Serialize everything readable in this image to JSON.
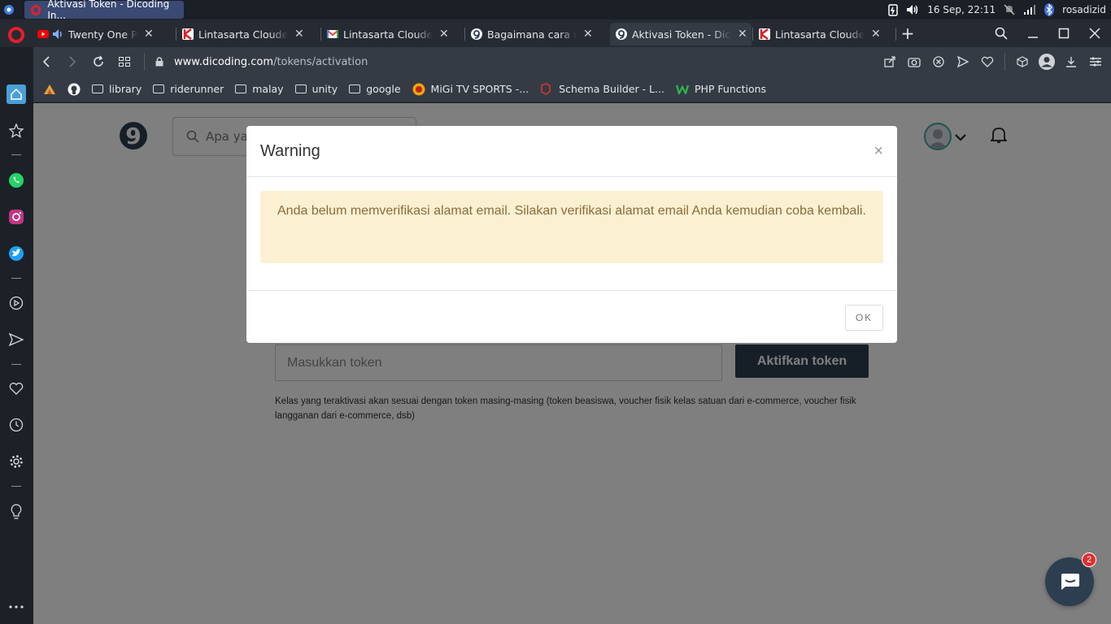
{
  "os": {
    "active_window_title": "Aktivasi Token - Dicoding In...",
    "datetime": "16 Sep, 22:11",
    "user": "rosadizid"
  },
  "tabs": [
    {
      "title": "Twenty One Pilots",
      "favicon": "youtube-icon",
      "active": false
    },
    {
      "title": "Lintasarta Cloudeka D",
      "favicon": "cloudeka-icon",
      "active": false
    },
    {
      "title": "Lintasarta Cloudeka D",
      "favicon": "gmail-icon",
      "active": false
    },
    {
      "title": "Bagaimana cara mem",
      "favicon": "dicoding-icon",
      "active": false
    },
    {
      "title": "Aktivasi Token - Dicod",
      "favicon": "dicoding-icon",
      "active": true
    },
    {
      "title": "Lintasarta Cloudeka D",
      "favicon": "cloudeka-icon",
      "active": false
    }
  ],
  "address": {
    "host": "www.dicoding.com",
    "path": "/tokens/activation"
  },
  "bookmarks": [
    {
      "label": "",
      "icon": "bookmark-app-icon"
    },
    {
      "label": "",
      "icon": "github-icon"
    },
    {
      "label": "library",
      "icon": "folder-icon"
    },
    {
      "label": "riderunner",
      "icon": "folder-icon"
    },
    {
      "label": "malay",
      "icon": "folder-icon"
    },
    {
      "label": "unity",
      "icon": "folder-icon"
    },
    {
      "label": "google",
      "icon": "folder-icon"
    },
    {
      "label": "MiGi TV SPORTS -...",
      "icon": "migi-icon"
    },
    {
      "label": "Schema Builder - L...",
      "icon": "laravel-icon"
    },
    {
      "label": "PHP Functions",
      "icon": "w-icon"
    }
  ],
  "page": {
    "search_placeholder": "Apa yang",
    "token_placeholder": "Masukkan token",
    "activate_button": "Aktifkan token",
    "help_text": "Kelas yang teraktivasi akan sesuai dengan token masing-masing (token beasiswa, voucher fisik kelas satuan dari e-commerce, voucher fisik langganan dari e-commerce, dsb)",
    "chat_badge": "2"
  },
  "modal": {
    "title": "Warning",
    "close": "×",
    "message": "Anda belum memverifikasi alamat email. Silakan verifikasi alamat email Anda kemudian coba kembali.",
    "ok": "OK"
  },
  "colors": {
    "brand_navy": "#2d3e50",
    "alert_bg": "#fcf0d2",
    "alert_text": "#8a6d3b",
    "opera_red": "#e81d2c"
  }
}
